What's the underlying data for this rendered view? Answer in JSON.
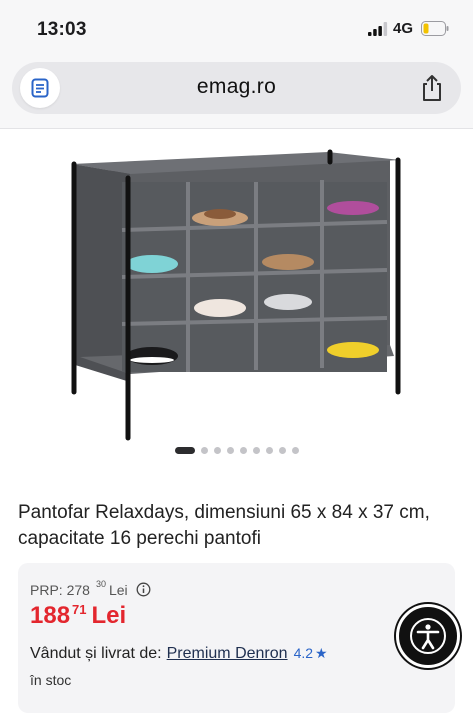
{
  "status_bar": {
    "time": "13:03",
    "network": "4G",
    "battery_level": 0.25
  },
  "browser": {
    "url": "emag.ro"
  },
  "product": {
    "image_slides_count": 9,
    "active_slide": 1,
    "title": "Pantofar Relaxdays, dimensiuni 65 x 84 x 37 cm, capacitate 16 perechi pantofi"
  },
  "pricing": {
    "prp_label": "PRP:",
    "prp_int": "278",
    "prp_dec": "30",
    "prp_currency": "Lei",
    "price_int": "188",
    "price_dec": "71",
    "price_currency": "Lei",
    "price_color": "#e3262e"
  },
  "seller": {
    "label": "Vândut și livrat de:",
    "name": "Premium Denron",
    "rating": "4.2",
    "star": "★"
  },
  "stock": "în stoc",
  "icons": {
    "reader": "reader-icon",
    "share": "share-icon",
    "info": "info-icon",
    "accessibility": "accessibility-icon"
  }
}
